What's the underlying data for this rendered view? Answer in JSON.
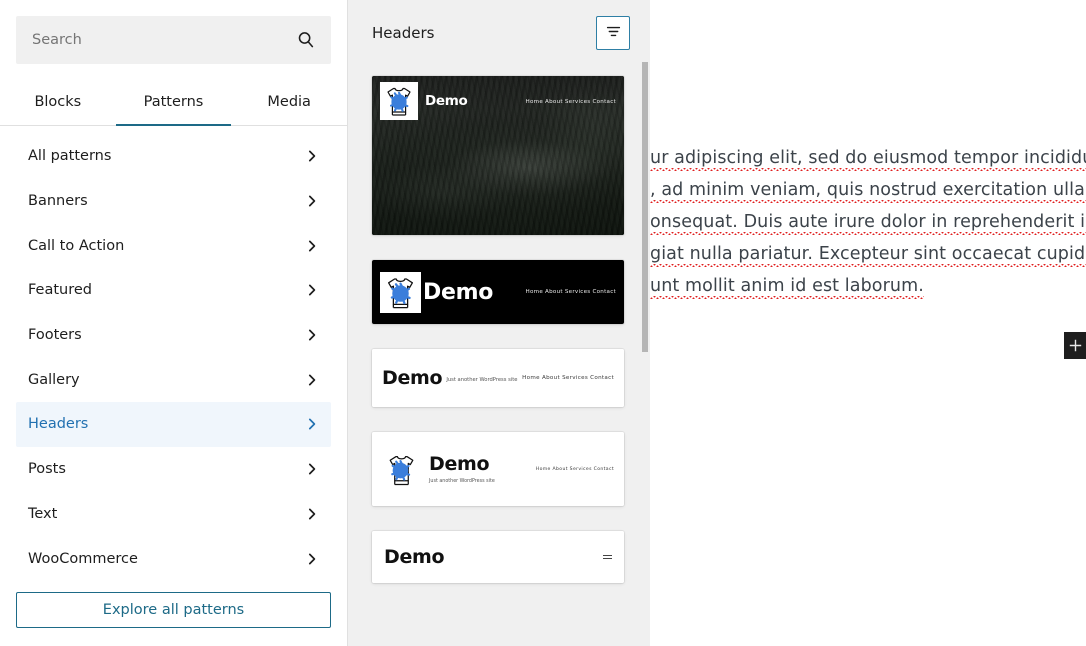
{
  "sidebar": {
    "search": {
      "placeholder": "Search",
      "value": "",
      "icon": "search-icon"
    },
    "tabs": [
      {
        "label": "Blocks",
        "active": false
      },
      {
        "label": "Patterns",
        "active": true
      },
      {
        "label": "Media",
        "active": false
      }
    ],
    "categories": [
      {
        "label": "All patterns",
        "active": false
      },
      {
        "label": "Banners",
        "active": false
      },
      {
        "label": "Call to Action",
        "active": false
      },
      {
        "label": "Featured",
        "active": false
      },
      {
        "label": "Footers",
        "active": false
      },
      {
        "label": "Gallery",
        "active": false
      },
      {
        "label": "Headers",
        "active": true
      },
      {
        "label": "Posts",
        "active": false
      },
      {
        "label": "Text",
        "active": false
      },
      {
        "label": "WooCommerce",
        "active": false
      }
    ],
    "explore_button": "Explore all patterns",
    "accent_color": "#1d6a87",
    "active_bg": "#f0f6fc",
    "active_text": "#2271b1"
  },
  "patterns_panel": {
    "title": "Headers",
    "filter_button": {
      "icon": "filter-icon",
      "label": ""
    },
    "patterns": [
      {
        "id": "header-image-dark",
        "style": "image-dark",
        "brand": "Demo",
        "tagline": "",
        "nav": "Home About Services Contact",
        "logo": "tshirt-splat-logo"
      },
      {
        "id": "header-black-bar",
        "style": "black-bar",
        "brand": "Demo",
        "tagline": "",
        "nav": "Home About Services Contact",
        "logo": "tshirt-splat-logo"
      },
      {
        "id": "header-white-tagline",
        "style": "white-tagline",
        "brand": "Demo",
        "tagline": "Just another WordPress site",
        "nav": "Home About Services Contact",
        "logo": ""
      },
      {
        "id": "header-white-logo",
        "style": "white-logo",
        "brand": "Demo",
        "tagline": "Just another WordPress site",
        "nav": "Home About Services Contact",
        "logo": "tshirt-splat-logo"
      },
      {
        "id": "header-white-menu",
        "style": "white-menu",
        "brand": "Demo",
        "tagline": "",
        "nav": "",
        "logo": ""
      }
    ],
    "background": "#f0f0f0"
  },
  "editor": {
    "paragraph_lines": [
      "ur adipiscing elit, sed do eiusmod tempor incididunt ut",
      ", ad minim veniam, quis nostrud exercitation ullamco",
      "onsequat. Duis aute irure dolor in reprehenderit in",
      "giat nulla pariatur. Excepteur sint occaecat cupidatat non",
      "unt mollit anim id est laborum."
    ],
    "inserter_icon": "plus-icon"
  }
}
